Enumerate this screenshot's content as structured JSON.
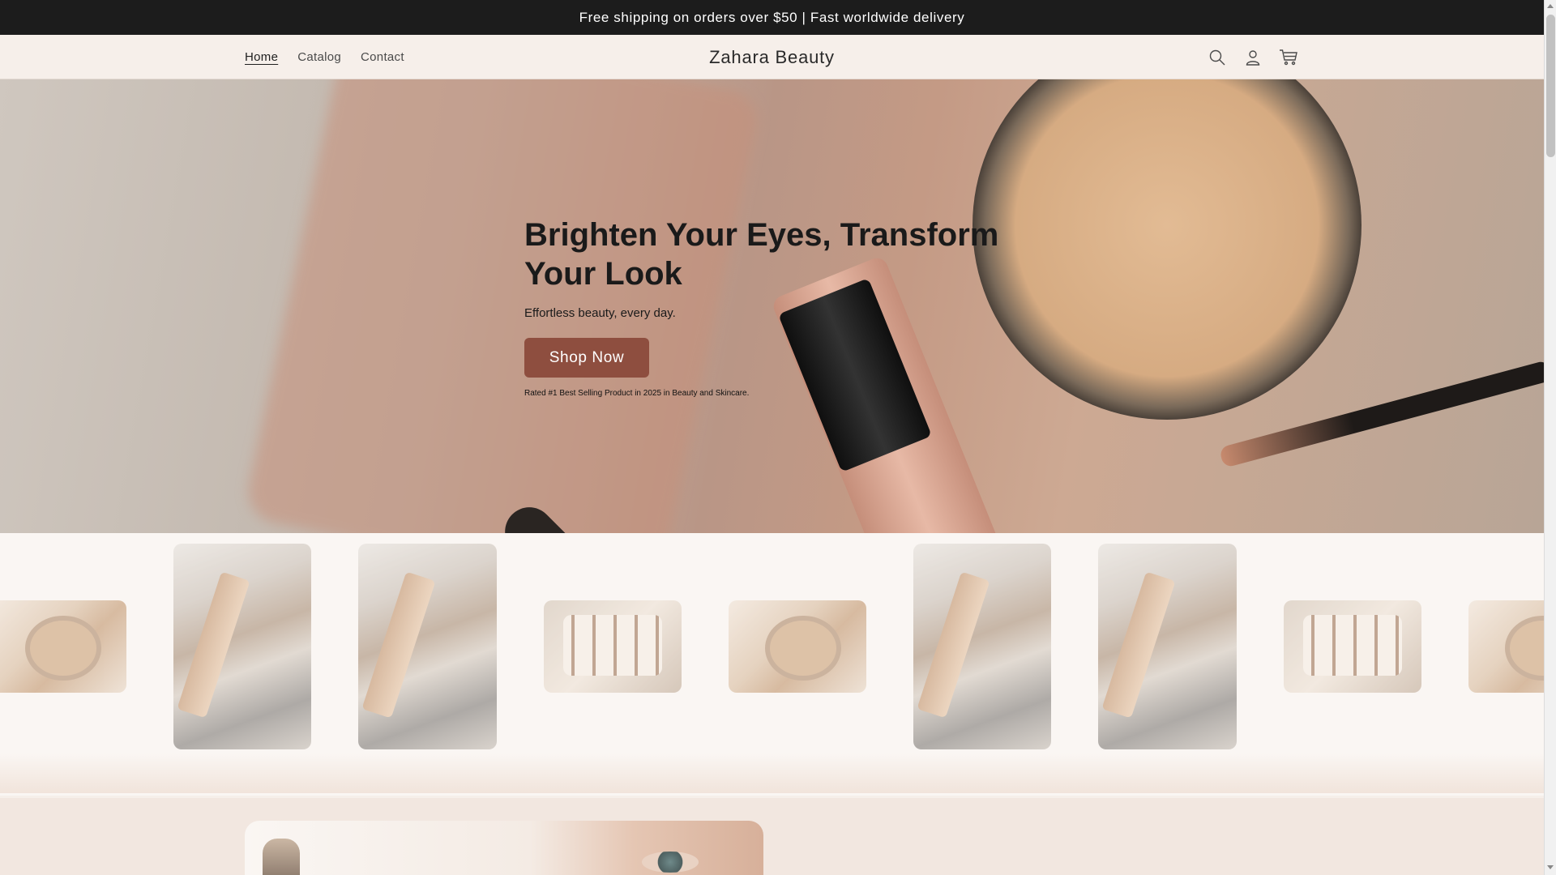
{
  "announcement": {
    "text": "Free shipping on orders over $50 | Fast worldwide delivery"
  },
  "header": {
    "logo": "Zahara Beauty",
    "nav": [
      {
        "label": "Home",
        "active": true
      },
      {
        "label": "Catalog",
        "active": false
      },
      {
        "label": "Contact",
        "active": false
      }
    ],
    "icons": [
      "search-icon",
      "account-icon",
      "cart-icon"
    ]
  },
  "hero": {
    "title": "Brighten Your Eyes, Transform Your Look",
    "subtitle": "Effortless beauty, every day.",
    "button_label": "Shop Now",
    "note": "Rated #1 Best Selling Product in 2025 in Beauty and Skincare."
  },
  "gallery": {
    "items": [
      "compact",
      "flatlay",
      "flatlay",
      "tray",
      "compact",
      "flatlay",
      "flatlay",
      "tray",
      "compact"
    ]
  },
  "colors": {
    "background": "#f6efea",
    "announcement_bg": "#1c1c1c",
    "button_bg": "#8e4e3f"
  }
}
